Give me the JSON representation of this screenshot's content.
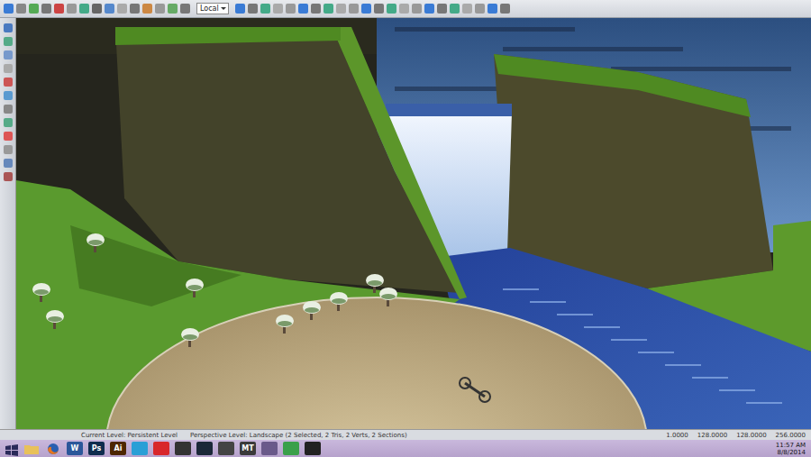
{
  "toolbar": {
    "dropdown": "Local"
  },
  "status_bar": {
    "level": "Current Level:  Persistent Level",
    "selection": "Perspective Level: Landscape (2 Selected, 2 Tris, 2 Verts, 2 Sections)",
    "readouts": [
      "1.0000",
      "128.0000",
      "128.0000",
      "256.0000"
    ]
  },
  "taskbar": {
    "apps": [
      {
        "kind": "folder"
      },
      {
        "kind": "firefox"
      },
      {
        "kind": "text",
        "label": "W",
        "color": "#2b579a"
      },
      {
        "kind": "text",
        "label": "Ps",
        "color": "#0e2c4e"
      },
      {
        "kind": "text",
        "label": "Ai",
        "color": "#4d2600"
      },
      {
        "kind": "glyph",
        "color": "#2a9fd6"
      },
      {
        "kind": "glyph",
        "color": "#d8262b"
      },
      {
        "kind": "glyph",
        "color": "#333333"
      },
      {
        "kind": "glyph",
        "color": "#1b2838"
      },
      {
        "kind": "glyph",
        "color": "#444444"
      },
      {
        "kind": "text",
        "label": "MT",
        "color": "#3a3a3a"
      },
      {
        "kind": "glyph",
        "color": "#6a5a8a"
      },
      {
        "kind": "glyph",
        "color": "#3aa04a"
      },
      {
        "kind": "glyph",
        "color": "#222222"
      }
    ]
  },
  "clock": {
    "time": "11:57 AM",
    "date": "8/8/2014"
  }
}
